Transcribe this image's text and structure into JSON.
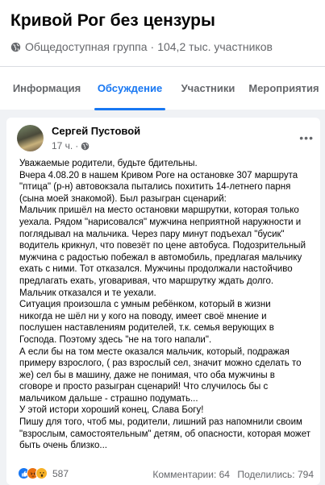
{
  "group": {
    "title": "Кривой Рог без цензуры",
    "privacy": "Общедоступная группа",
    "separator": "·",
    "members": "104,2 тыс. участников"
  },
  "tabs": [
    {
      "label": "Информация",
      "active": false
    },
    {
      "label": "Обсуждение",
      "active": true
    },
    {
      "label": "Участники",
      "active": false
    },
    {
      "label": "Мероприятия",
      "active": false
    }
  ],
  "post": {
    "author": "Сергей Пустовой",
    "time": "17 ч.",
    "time_separator": "·",
    "more": "•••",
    "lines": [
      "Уважаемые родители, будьте бдительны.",
      "Вчера 4.08.20 в нашем Кривом Роге на остановке 307 маршрута",
      "\"птица\" (р-н) автовокзала пытались похитить 14-летнего парня",
      "(сына моей знакомой). Был разыгран сценарий:",
      "Мальчик пришёл на место остановки маршрутки, которая только",
      "уехала. Рядом \"нарисовался\" мужчина неприятной наружности и",
      "поглядывал на мальчика.  Через пару минут подъехал \"бусик\"",
      "водитель крикнул, что повезёт по цене автобуса. Подозрительный",
      "мужчина с радостью побежал в автомобиль, предлагая мальчику",
      "ехать с ними. Тот отказался. Мужчины продолжали настойчиво",
      "предлагать ехать, уговаривая, что маршрутку ждать долго.",
      "Мальчик отказался и те уехали.",
      "Ситуация произошла с умным ребёнком, который в жизни",
      "никогда не шёл ни у кого на поводу, имеет своё мнение и",
      "послушен наставлениям родителей, т.к. семья верующих в",
      "Господа. Поэтому здесь \"не на того напали\".",
      "А если бы на том месте оказался мальчик, который, подражая",
      "примеру взрослого, ( раз взрослый сел, значит можно сделать то",
      "же) сел бы в машину, даже не понимая, что оба мужчины в",
      "сговоре и просто разыгран сценарий! Что случилось бы с",
      "мальчиком дальше - страшно подумать...",
      "У этой истори хороший конец, Слава Богу!",
      "Пишу для того, чтоб мы, родители, лишний раз напомнили своим",
      "\"взрослым, самостоятельным\" детям, об опасности, которая может",
      "быть очень близко..."
    ],
    "reactions": {
      "icons": [
        "like-reaction",
        "angry-reaction",
        "wow-reaction"
      ],
      "count": "587"
    },
    "comments": "Комментарии: 64",
    "shares": "Поделились: 794"
  },
  "colors": {
    "accent": "#1877f2",
    "secondary_text": "#65676b",
    "background": "#f0f2f5"
  }
}
